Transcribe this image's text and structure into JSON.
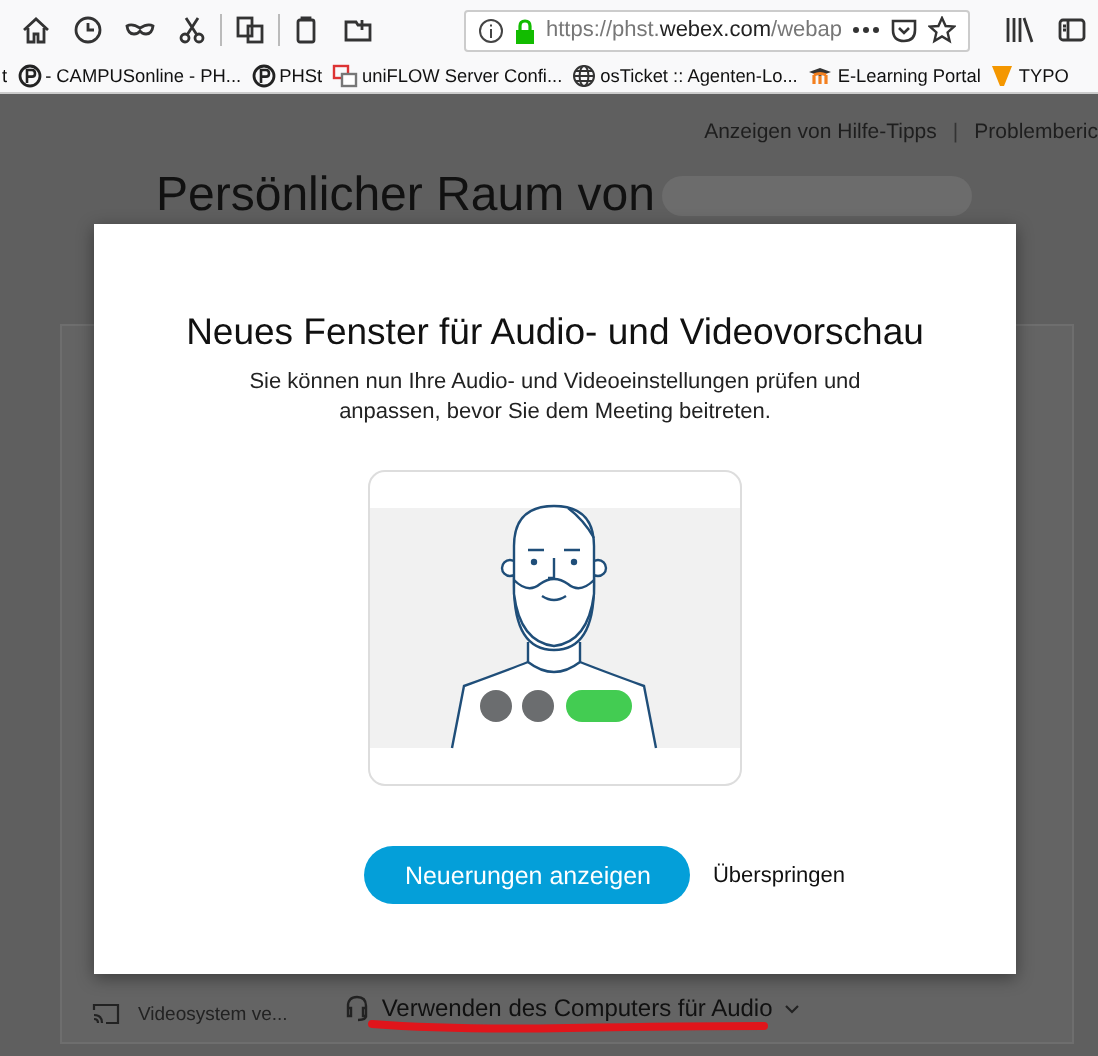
{
  "browser": {
    "url": {
      "prefix": "https://phst.",
      "domain": "webex.com",
      "path": "/webap"
    },
    "bookmarks": [
      {
        "kind": "none",
        "label": "t"
      },
      {
        "kind": "p-logo",
        "label": "- CAMPUSonline - PH..."
      },
      {
        "kind": "p-logo",
        "label": "PHSt"
      },
      {
        "kind": "tiles",
        "label": "uniFLOW Server Confi..."
      },
      {
        "kind": "globe",
        "label": "osTicket :: Agenten-Lo..."
      },
      {
        "kind": "cap",
        "label": "E-Learning Portal"
      },
      {
        "kind": "cone",
        "label": "TYPO"
      }
    ]
  },
  "page": {
    "header_links": [
      {
        "kind": "link",
        "text": "Anzeigen von Hilfe-Tipps"
      },
      {
        "kind": "divider",
        "text": "|"
      },
      {
        "kind": "link",
        "text": "Problemberic"
      }
    ],
    "title": "Persönlicher Raum von",
    "bottom_bar": {
      "video_system": "Videosystem ve...",
      "audio": "Verwenden des Computers für Audio"
    }
  },
  "dialog": {
    "title": "Neues Fenster für Audio- und Videovorschau",
    "description": "Sie können nun Ihre Audio- und Videoeinstellungen prüfen und anpassen, bevor Sie dem Meeting beitreten.",
    "primary_button": "Neuerungen anzeigen",
    "skip_link": "Überspringen"
  }
}
